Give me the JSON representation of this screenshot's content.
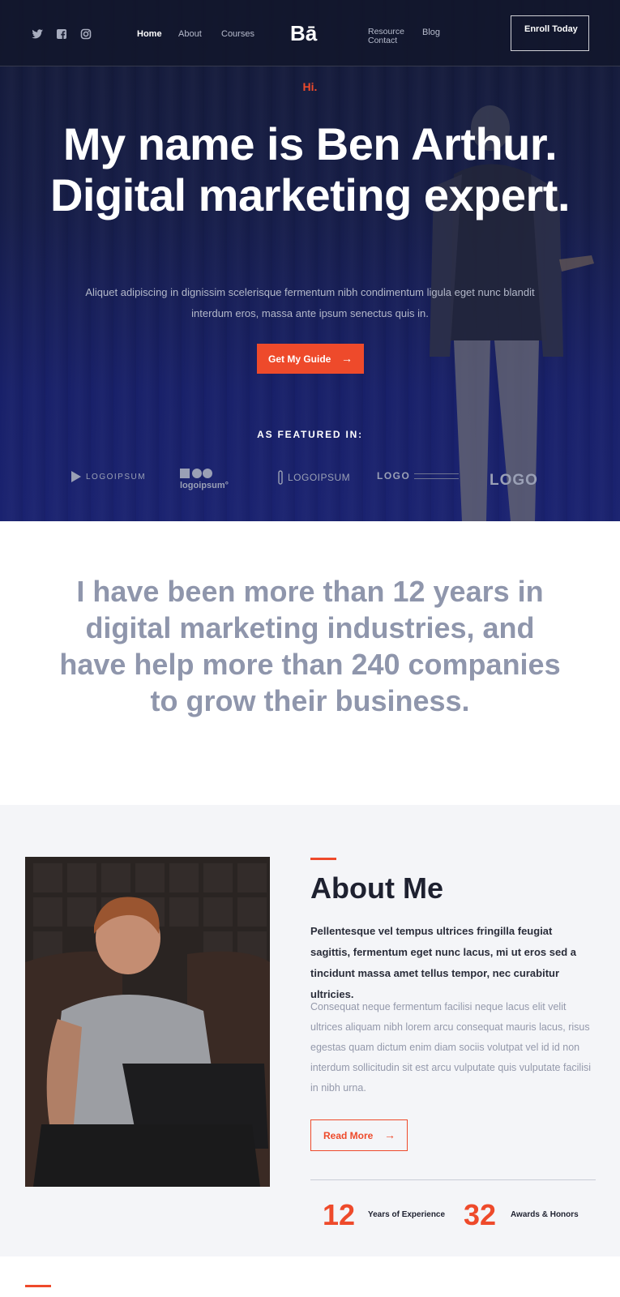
{
  "header": {
    "brand": "Bā",
    "nav": [
      {
        "label": "Home"
      },
      {
        "label": "About"
      },
      {
        "label": "Courses"
      },
      {
        "label": "Resource"
      },
      {
        "label": "Contact"
      },
      {
        "label": "Blog"
      }
    ],
    "enroll_label": "Enroll Today",
    "social_icons": [
      "twitter-icon",
      "facebook-icon",
      "instagram-icon"
    ]
  },
  "hero": {
    "greeting": "Hi.",
    "headline": "My name is Ben Arthur. Digital marketing expert.",
    "subtext": "Aliquet adipiscing in dignissim scelerisque fermentum nibh condimentum ligula eget nunc blandit interdum eros, massa ante ipsum senectus quis in.",
    "cta_label": "Get My Guide",
    "featured_label": "AS FEATURED IN:",
    "logos": [
      "LOGOIPSUM",
      "logoipsum°",
      "LOGOIPSUM",
      "LOGO",
      "LOGO"
    ]
  },
  "statement": {
    "text": "I have been more than 12 years in digital marketing industries, and have help more than 240 companies to grow their business."
  },
  "about": {
    "title": "About Me",
    "lead": "Pellentesque vel tempus ultrices fringilla feugiat sagittis, fermentum eget nunc lacus, mi ut eros sed a tincidunt massa amet tellus tempor, nec curabitur ultricies.",
    "body": "Consequat neque fermentum facilisi neque lacus elit velit ultrices aliquam nibh lorem arcu consequat mauris lacus, risus egestas quam dictum enim diam sociis volutpat vel id id non interdum sollicitudin sit est arcu vulputate quis vulputate facilisi in nibh urna.",
    "read_more_label": "Read More",
    "stats": [
      {
        "value": "12",
        "label": "Years of Experience"
      },
      {
        "value": "32",
        "label": "Awards & Honors"
      }
    ]
  },
  "colors": {
    "accent": "#ee4a2b",
    "hero_dark": "#141a36",
    "text_dark": "#1e2130",
    "muted": "#8f96ac"
  }
}
